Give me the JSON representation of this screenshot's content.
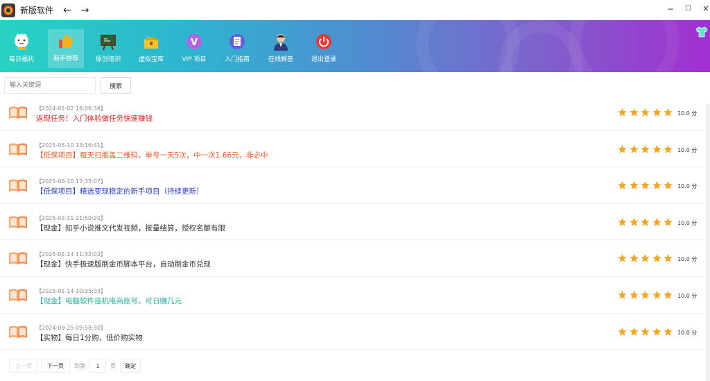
{
  "window": {
    "title": "新版软件",
    "back": "←",
    "forward": "→",
    "minimize": "−",
    "maximize": "☐",
    "close": "×"
  },
  "nav": {
    "items": [
      {
        "label": "每日福利",
        "icon": "lucky-cat-icon",
        "color": "#ffffff"
      },
      {
        "label": "新手推荐",
        "icon": "thumbs-up-icon",
        "color": "#f5b21b"
      },
      {
        "label": "原创培训",
        "icon": "chalkboard-icon",
        "color": "#5a3a1a"
      },
      {
        "label": "虚拟宝库",
        "icon": "treasure-icon",
        "color": "#f1c232"
      },
      {
        "label": "VIP 项目",
        "icon": "vip-icon",
        "color": "#9b59d6"
      },
      {
        "label": "入门指南",
        "icon": "document-icon",
        "color": "#6a5ae0"
      },
      {
        "label": "在线解答",
        "icon": "support-agent-icon",
        "color": "#2d3e7c"
      },
      {
        "label": "退出登录",
        "icon": "power-icon",
        "color": "#e53935"
      }
    ],
    "active_index": 1
  },
  "search": {
    "placeholder": "输入关键词",
    "button": "搜索"
  },
  "list": {
    "items": [
      {
        "date": "【2024-01-02 16:06:38】",
        "title": "返现任务！入门体验做任务快速赚钱",
        "color": "#e02020",
        "rating": 5,
        "score": "10.0 分"
      },
      {
        "date": "【2025-05-10 13:16:41】",
        "title": "【低保项目】每天扫瓶盖二维码，单号一天5次，中一次1.66元，非必中",
        "color": "#f05a28",
        "rating": 5,
        "score": "10.0 分"
      },
      {
        "date": "【2025-03-10 12:35:07】",
        "title": "【低保项目】精选变现稳定的新手项目（持续更新）",
        "color": "#2b3fc8",
        "rating": 5,
        "score": "10.0 分"
      },
      {
        "date": "【2025-02-11 21:50:20】",
        "title": "【现金】知乎小说推文代发视频，按量结算，授权名额有限",
        "color": "#333333",
        "rating": 5,
        "score": "10.0 分"
      },
      {
        "date": "【2025-01-14 11:32:03】",
        "title": "【现金】快手极速版刷金币脚本平台，自动刷金币兑现",
        "color": "#333333",
        "rating": 5,
        "score": "10.0 分"
      },
      {
        "date": "【2025-01-14 10:35:03】",
        "title": "【现金】电脑软件挂机电商账号，可日赚几元",
        "color": "#1fb39a",
        "rating": 5,
        "score": "10.0 分"
      },
      {
        "date": "【2024-09-25 09:58:30】",
        "title": "【实物】每日1分购，低价购实物",
        "color": "#333333",
        "rating": 5,
        "score": "10.0 分"
      }
    ],
    "star_color": "#f5a623"
  },
  "pager": {
    "prev": "上一页",
    "next": "下一页",
    "goto": "到第",
    "page_value": "1",
    "page_unit": "页",
    "confirm": "确定"
  }
}
